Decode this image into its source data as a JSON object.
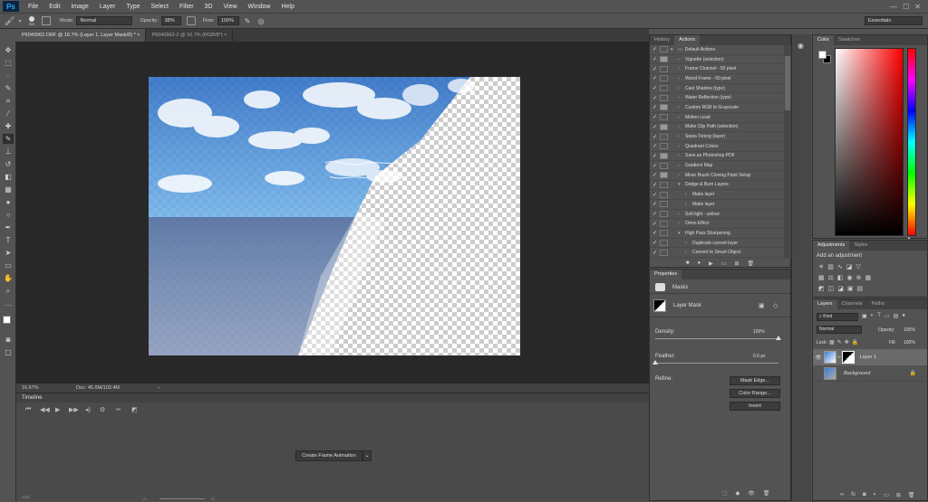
{
  "app": {
    "logo": "Ps"
  },
  "menu": [
    "File",
    "Edit",
    "Image",
    "Layer",
    "Type",
    "Select",
    "Filter",
    "3D",
    "View",
    "Window",
    "Help"
  ],
  "options": {
    "brush_size": "300",
    "mode_label": "Mode:",
    "mode_value": "Normal",
    "opacity_label": "Opacity:",
    "opacity_value": "38%",
    "flow_label": "Flow:",
    "flow_value": "100%",
    "workspace": "Essentials"
  },
  "tabs": [
    {
      "label": "P6040962.ORF @ 16.7% (Layer 1, Layer Mask/8) *",
      "close": "×"
    },
    {
      "label": "P6040962-2 @ 16.7% (RGB/8*)",
      "close": "×"
    }
  ],
  "status": {
    "zoom": "16.67%",
    "doc": "Doc: 45.6M/103.4M",
    "arrow": "›"
  },
  "timeline": {
    "title": "Timeline",
    "create_button": "Create Frame Animation",
    "dropdown": "⌄"
  },
  "history_panel": {
    "tabs": [
      "History",
      "Actions"
    ]
  },
  "actions": [
    {
      "label": "Default Actions",
      "indent": 0,
      "expanded": true,
      "folder": true,
      "dialog": false
    },
    {
      "label": "Vignette (selection)",
      "indent": 1,
      "dialog": true
    },
    {
      "label": "Frame Channel - 50 pixel",
      "indent": 1,
      "dialog": false
    },
    {
      "label": "Wood Frame - 50 pixel",
      "indent": 1,
      "dialog": false
    },
    {
      "label": "Cast Shadow (type)",
      "indent": 1,
      "dialog": false
    },
    {
      "label": "Water Reflection (type)",
      "indent": 1,
      "dialog": false
    },
    {
      "label": "Custom RGB to Grayscale",
      "indent": 1,
      "dialog": true
    },
    {
      "label": "Molten Lead",
      "indent": 1,
      "dialog": false
    },
    {
      "label": "Make Clip Path (selection)",
      "indent": 1,
      "dialog": true
    },
    {
      "label": "Sepia Toning (layer)",
      "indent": 1,
      "dialog": false
    },
    {
      "label": "Quadrant Colors",
      "indent": 1,
      "dialog": false
    },
    {
      "label": "Save as Photoshop PDF",
      "indent": 1,
      "dialog": true
    },
    {
      "label": "Gradient Map",
      "indent": 1,
      "dialog": false
    },
    {
      "label": "Mixer Brush Cloning Paint Setup",
      "indent": 1,
      "dialog": true
    },
    {
      "label": "Dodge & Burn Layers",
      "indent": 1,
      "expanded": true,
      "dialog": false
    },
    {
      "label": "Make layer",
      "indent": 2,
      "dialog": false
    },
    {
      "label": "Make layer",
      "indent": 2,
      "dialog": false
    },
    {
      "label": "Soft light - yellow",
      "indent": 1,
      "dialog": false
    },
    {
      "label": "Orton Effect",
      "indent": 1,
      "dialog": false
    },
    {
      "label": "High Pass Sharpening",
      "indent": 1,
      "expanded": true,
      "dialog": false
    },
    {
      "label": "Duplicate current layer",
      "indent": 2,
      "dialog": false
    },
    {
      "label": "Convert to Smart Object",
      "indent": 2,
      "dialog": false
    }
  ],
  "properties": {
    "title": "Properties",
    "masks_label": "Masks",
    "layer_mask": "Layer Mask",
    "density_label": "Density:",
    "density_value": "100%",
    "density_level": 1.0,
    "feather_label": "Feather:",
    "feather_value": "0.0 px",
    "feather_level": 0.0,
    "refine_label": "Refine:",
    "buttons": [
      "Mask Edge...",
      "Color Range...",
      "Invert"
    ]
  },
  "color_panel": {
    "tabs": [
      "Color",
      "Swatches"
    ],
    "foreground": "#ffffff",
    "background": "#000000",
    "hue_color": "#ff0000"
  },
  "adjustments": {
    "tabs": [
      "Adjustments",
      "Styles"
    ],
    "hint": "Add an adjustment"
  },
  "layers_panel": {
    "tabs": [
      "Layers",
      "Channels",
      "Paths"
    ],
    "filter": "Kind",
    "blend_mode": "Normal",
    "opacity_label": "Opacity:",
    "opacity_value": "100%",
    "lock_label": "Lock:",
    "fill_label": "Fill:",
    "fill_value": "100%",
    "layers": [
      {
        "name": "Layer 1",
        "visible": true,
        "selected": true
      },
      {
        "name": "Background",
        "visible": false,
        "selected": false,
        "locked": true
      }
    ]
  },
  "colors": {
    "accent": "#31a8ff",
    "panel_bg": "#535353",
    "canvas_bg": "#282828"
  }
}
